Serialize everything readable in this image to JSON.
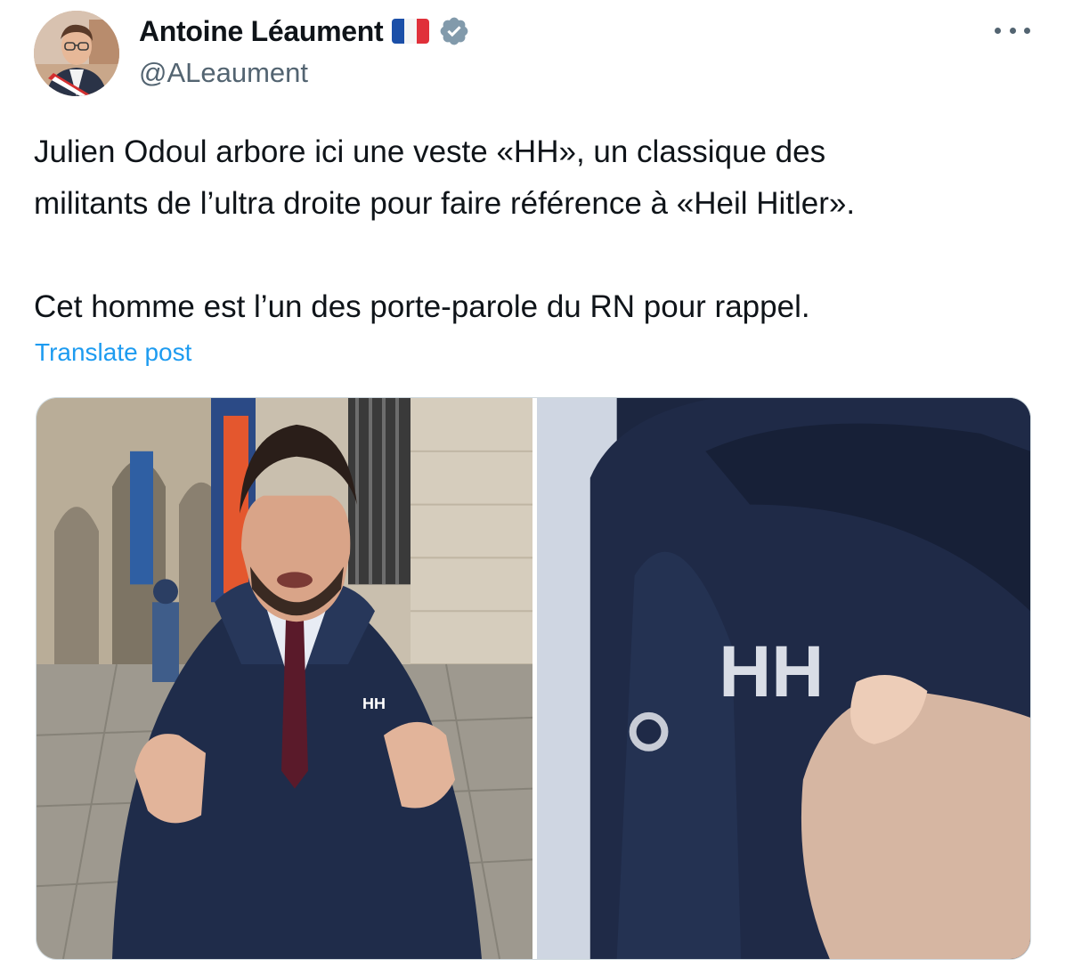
{
  "author": {
    "display_name": "Antoine Léaument",
    "handle": "@ALeaument",
    "flag": "french-flag-icon",
    "verified": true
  },
  "post": {
    "lines": [
      "Julien Odoul arbore ici une veste «HH», un classique des",
      "militants de l’ultra droite pour faire référence à «Heil Hitler».",
      "Cet homme est l’un des porte-parole du RN pour rappel."
    ],
    "translate_label": "Translate post"
  },
  "media": {
    "images": [
      {
        "name": "photo-man-in-jacket",
        "jacket_logo": "HH"
      },
      {
        "name": "photo-jacket-logo-closeup",
        "jacket_logo": "HH"
      }
    ]
  },
  "colors": {
    "text": "#0f1419",
    "secondary": "#536471",
    "link": "#1d9bf0",
    "verified_badge": "#829aab",
    "jacket_navy": "#1f2c4a"
  },
  "icons": {
    "more": "more-dots-icon",
    "verified": "verified-badge-icon"
  }
}
